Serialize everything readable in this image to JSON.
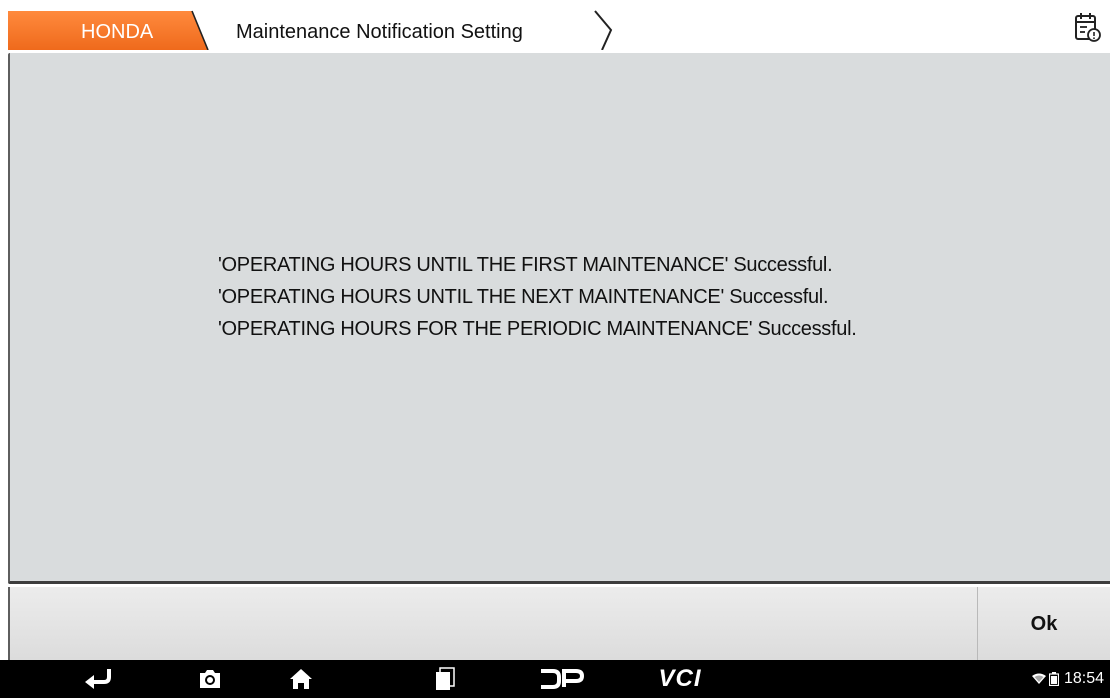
{
  "header": {
    "breadcrumb": [
      "HONDA",
      "Maintenance Notification Setting"
    ],
    "brand_color": "#f26f21",
    "report_icon": "calendar-report-icon"
  },
  "main": {
    "messages": [
      "'OPERATING HOURS UNTIL THE FIRST MAINTENANCE' Successful.",
      "'OPERATING HOURS UNTIL THE NEXT MAINTENANCE' Successful.",
      "'OPERATING HOURS FOR THE PERIODIC MAINTENANCE' Successful."
    ]
  },
  "actions": {
    "ok_label": "Ok"
  },
  "navbar": {
    "icons": [
      "back-icon",
      "screenshot-icon",
      "home-icon",
      "recents-icon",
      "dp-icon"
    ],
    "vci_label": "VCI",
    "status": {
      "icons": [
        "wifi-icon",
        "battery-icon"
      ],
      "time": "18:54"
    }
  }
}
